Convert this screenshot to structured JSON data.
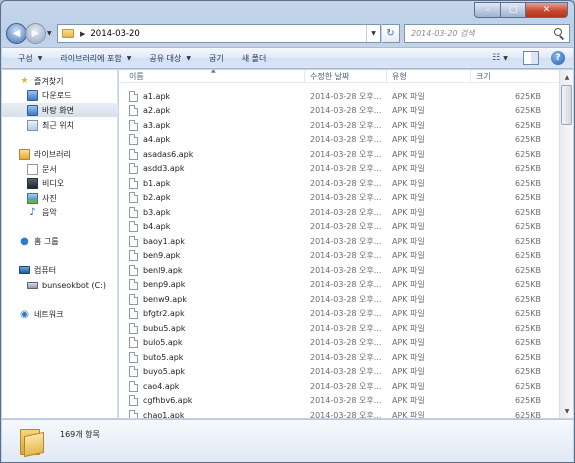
{
  "window": {
    "caption_min": "–",
    "caption_max": "□",
    "caption_close": "✕"
  },
  "address": {
    "path": "2014-03-20",
    "refresh": "↻"
  },
  "search": {
    "placeholder": "2014-03-20 검색"
  },
  "commands": {
    "organize": "구성",
    "include_library": "라이브러리에 포함",
    "share_with": "공유 대상",
    "burn": "굽기",
    "new_folder": "새 폴더"
  },
  "nav": {
    "favorites": "즐겨찾기",
    "downloads": "다운로드",
    "desktop": "바탕 화면",
    "recent": "최근 위치",
    "libraries": "라이브러리",
    "documents": "문서",
    "videos": "비디오",
    "pictures": "사진",
    "music": "음악",
    "homegroup": "홈 그룹",
    "computer": "컴퓨터",
    "drive": "bunseokbot (C:)",
    "network": "네트워크"
  },
  "columns": {
    "name": "이름",
    "date": "수정한 날짜",
    "type": "유형",
    "size": "크기"
  },
  "files": [
    {
      "name": "a1.apk",
      "date": "2014-03-28 오후...",
      "type": "APK 파일",
      "size": "625KB"
    },
    {
      "name": "a2.apk",
      "date": "2014-03-28 오후...",
      "type": "APK 파일",
      "size": "625KB"
    },
    {
      "name": "a3.apk",
      "date": "2014-03-28 오후...",
      "type": "APK 파일",
      "size": "625KB"
    },
    {
      "name": "a4.apk",
      "date": "2014-03-28 오후...",
      "type": "APK 파일",
      "size": "625KB"
    },
    {
      "name": "asadas6.apk",
      "date": "2014-03-28 오후...",
      "type": "APK 파일",
      "size": "625KB"
    },
    {
      "name": "asdd3.apk",
      "date": "2014-03-28 오후...",
      "type": "APK 파일",
      "size": "625KB"
    },
    {
      "name": "b1.apk",
      "date": "2014-03-28 오후...",
      "type": "APK 파일",
      "size": "625KB"
    },
    {
      "name": "b2.apk",
      "date": "2014-03-28 오후...",
      "type": "APK 파일",
      "size": "625KB"
    },
    {
      "name": "b3.apk",
      "date": "2014-03-28 오후...",
      "type": "APK 파일",
      "size": "625KB"
    },
    {
      "name": "b4.apk",
      "date": "2014-03-28 오후...",
      "type": "APK 파일",
      "size": "625KB"
    },
    {
      "name": "baoy1.apk",
      "date": "2014-03-28 오후...",
      "type": "APK 파일",
      "size": "625KB"
    },
    {
      "name": "ben9.apk",
      "date": "2014-03-28 오후...",
      "type": "APK 파일",
      "size": "625KB"
    },
    {
      "name": "benl9.apk",
      "date": "2014-03-28 오후...",
      "type": "APK 파일",
      "size": "625KB"
    },
    {
      "name": "benp9.apk",
      "date": "2014-03-28 오후...",
      "type": "APK 파일",
      "size": "625KB"
    },
    {
      "name": "benw9.apk",
      "date": "2014-03-28 오후...",
      "type": "APK 파일",
      "size": "625KB"
    },
    {
      "name": "bfgtr2.apk",
      "date": "2014-03-28 오후...",
      "type": "APK 파일",
      "size": "625KB"
    },
    {
      "name": "bubu5.apk",
      "date": "2014-03-28 오후...",
      "type": "APK 파일",
      "size": "625KB"
    },
    {
      "name": "bulo5.apk",
      "date": "2014-03-28 오후...",
      "type": "APK 파일",
      "size": "625KB"
    },
    {
      "name": "buto5.apk",
      "date": "2014-03-28 오후...",
      "type": "APK 파일",
      "size": "625KB"
    },
    {
      "name": "buyo5.apk",
      "date": "2014-03-28 오후...",
      "type": "APK 파일",
      "size": "625KB"
    },
    {
      "name": "cao4.apk",
      "date": "2014-03-28 오후...",
      "type": "APK 파일",
      "size": "625KB"
    },
    {
      "name": "cgfhbv6.apk",
      "date": "2014-03-28 오후...",
      "type": "APK 파일",
      "size": "625KB"
    },
    {
      "name": "chao1.apk",
      "date": "2014-03-28 오후...",
      "type": "APK 파일",
      "size": "625KB"
    }
  ],
  "status": {
    "count": "169개 항목"
  }
}
